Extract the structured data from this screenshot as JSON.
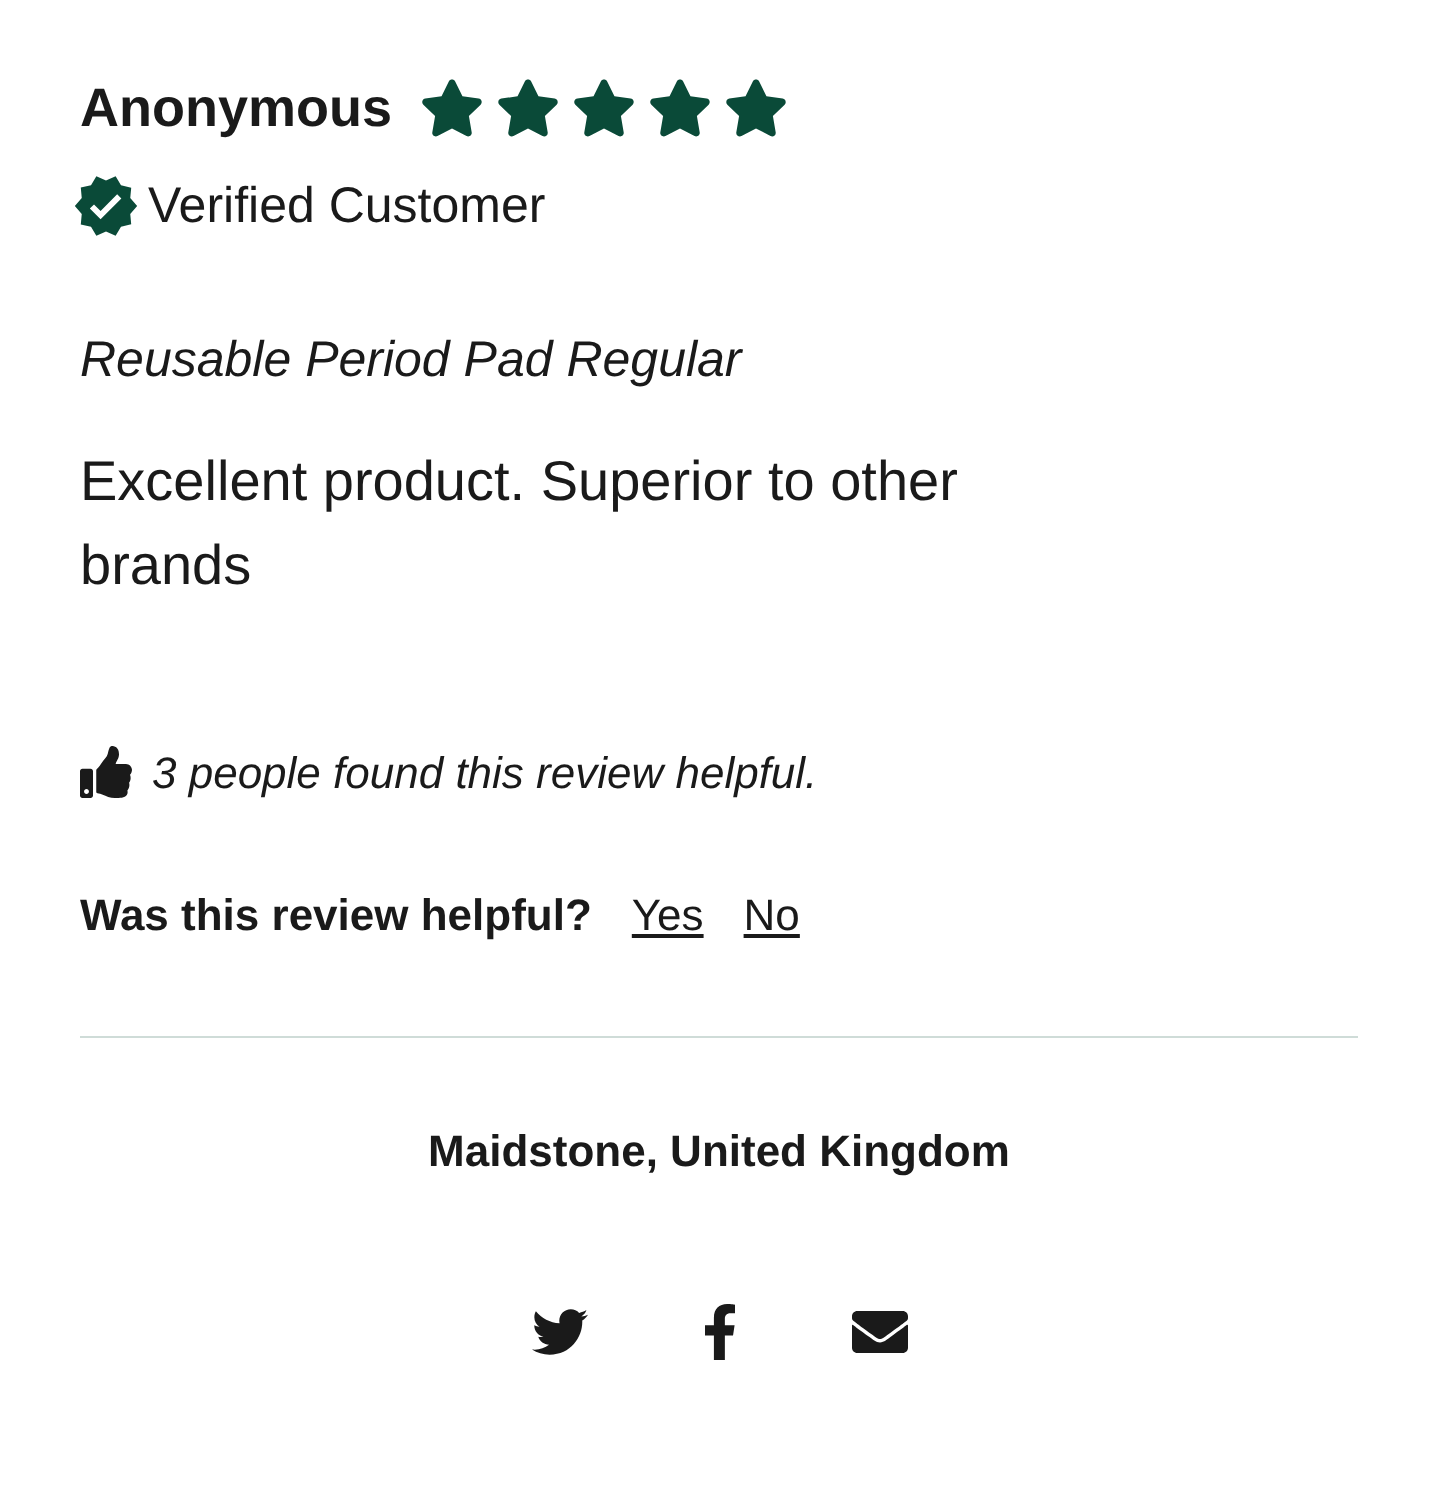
{
  "review": {
    "author": "Anonymous",
    "stars": 5,
    "verified": true,
    "verified_label": "Verified Customer",
    "product": "Reusable Period Pad Regular",
    "body": "Excellent product. Superior to other brands",
    "helpful_count": "3 people found this review helpful.",
    "helpful_question": "Was this review helpful?",
    "votes": [
      "Yes",
      "No"
    ],
    "location": "Maidstone, United Kingdom"
  }
}
